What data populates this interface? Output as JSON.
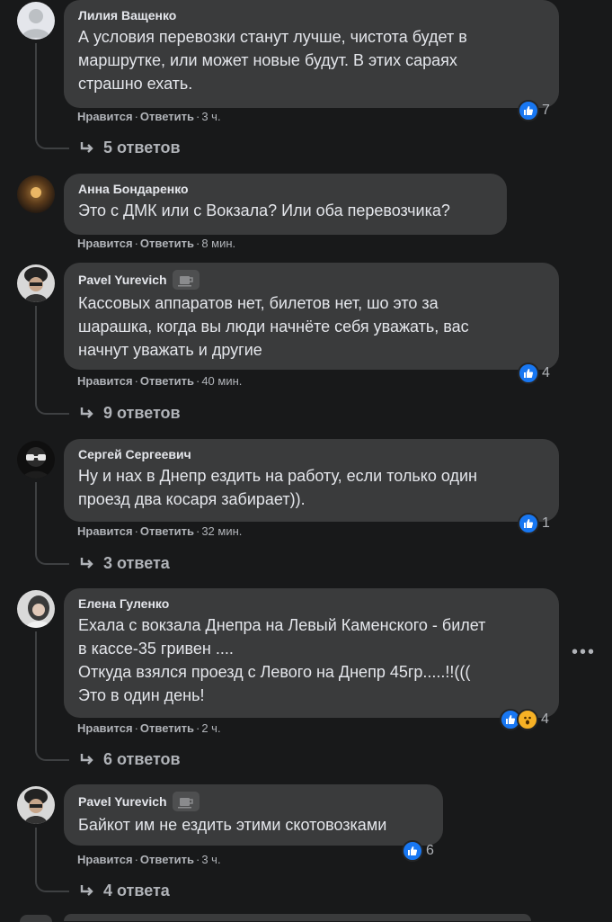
{
  "labels": {
    "like": "Нравится",
    "reply": "Ответить",
    "sep": "·"
  },
  "comments": [
    {
      "author": "Лилия Ващенко",
      "text_lines": [
        "А условия перевозки станут лучше, чистота будет в",
        "маршрутке, или может новые будут. В этих сараях",
        "страшно ехать."
      ],
      "time": "3 ч.",
      "reaction_count": "7",
      "replies": "5 ответов",
      "avatar_icon": "default-user-icon"
    },
    {
      "author": "Анна Бондаренко",
      "text_lines": [
        "Это с ДМК или с Вокзала? Или оба перевозчика?"
      ],
      "time": "8 мин.",
      "avatar_icon": "photo-avatar"
    },
    {
      "author": "Pavel Yurevich",
      "text_lines": [
        "Кассовых аппаратов нет, билетов нет, шо это за",
        "шарашка, когда вы люди начнёте себя уважать, вас",
        "начнут уважать и другие"
      ],
      "time": "40 мин.",
      "reaction_count": "4",
      "replies": "9 ответов",
      "badge_icon": "coffee-cup-badge-icon"
    },
    {
      "author": "Сергей Сергеевич",
      "text_lines": [
        "Ну и нах в Днепр ездить на работу, если только один",
        "проезд два косаря забирает))."
      ],
      "time": "32 мин.",
      "reaction_count": "1",
      "replies": "3 ответа"
    },
    {
      "author": "Елена Гуленко",
      "text_lines": [
        "Ехала с вокзала Днепра на Левый Каменского - билет",
        "в кассе-35 гривен ....",
        "Откуда взялся проезд с Левого на Днепр 45гр.....!!(((",
        "Это в один день!"
      ],
      "time": "2 ч.",
      "reaction_count": "4",
      "replies": "6 ответов",
      "more": "•••"
    },
    {
      "author": "Pavel Yurevich",
      "text_lines": [
        "Байкот им не ездить этими скотовозками"
      ],
      "time": "3 ч.",
      "reaction_count": "6",
      "replies": "4 ответа",
      "badge_icon": "coffee-cup-badge-icon"
    }
  ],
  "colors": {
    "background": "#18191a",
    "bubble": "#3a3b3c",
    "like": "#1877f2",
    "wow": "#f7b125",
    "secondary_text": "#b0b3b8"
  }
}
